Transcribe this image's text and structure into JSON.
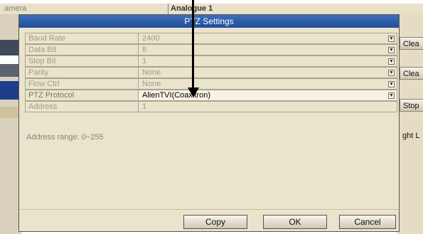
{
  "background": {
    "camera_label": "amera",
    "channel_label": "Analogue 1",
    "right_buttons": [
      "Clea",
      "Clea",
      "Stop",
      "ght L"
    ]
  },
  "dialog": {
    "title": "PTZ Settings",
    "fields": [
      {
        "label": "Baud Rate",
        "value": "2400"
      },
      {
        "label": "Data Bit",
        "value": "8"
      },
      {
        "label": "Stop Bit",
        "value": "1"
      },
      {
        "label": "Parity",
        "value": "None"
      },
      {
        "label": "Flow Ctrl",
        "value": "None"
      },
      {
        "label": "PTZ Protocol",
        "value": "AlienTVI(Coaxitron)"
      },
      {
        "label": "Address",
        "value": "1"
      }
    ],
    "address_range": "Address range: 0~255",
    "buttons": {
      "copy": "Copy",
      "ok": "OK",
      "cancel": "Cancel"
    }
  },
  "colors": {
    "title_bar": "#2a5aa6",
    "panel": "#ebe4cd",
    "annotation_arrow": "#000000"
  },
  "icons": {
    "dropdown": "chevron-down-icon",
    "annotation": "arrow-down-icon"
  }
}
